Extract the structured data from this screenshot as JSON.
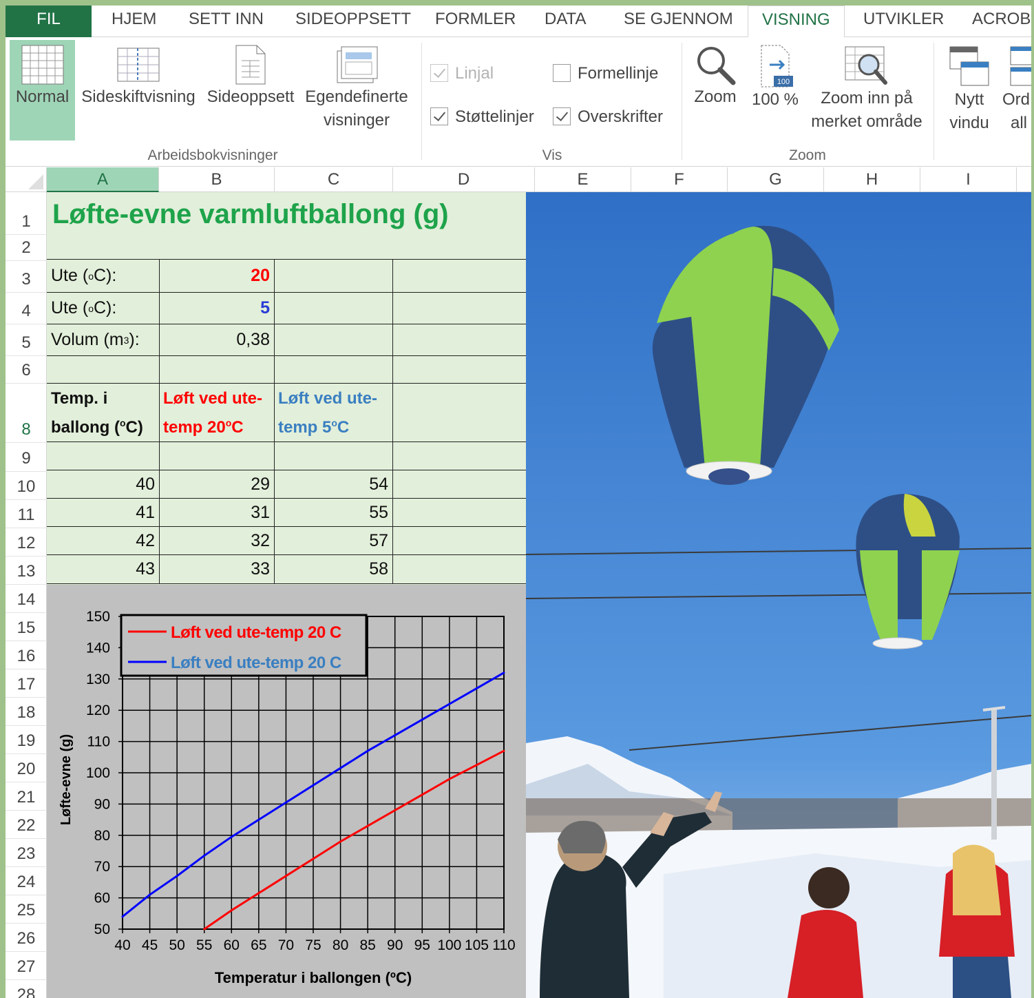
{
  "ribbon": {
    "tabs": [
      "FIL",
      "HJEM",
      "SETT INN",
      "SIDEOPPSETT",
      "FORMLER",
      "DATA",
      "SE GJENNOM",
      "VISNING",
      "UTVIKLER",
      "ACROB"
    ],
    "workbook_views": {
      "normal": "Normal",
      "page_break": "Sideskiftvisning",
      "page_layout": "Sideoppsett",
      "custom_1": "Egendefinerte",
      "custom_2": "visninger",
      "group": "Arbeidsbokvisninger"
    },
    "show": {
      "ruler": "Linjal",
      "formula_bar": "Formellinje",
      "gridlines": "Støttelinjer",
      "headings": "Overskrifter",
      "group": "Vis"
    },
    "zoom": {
      "zoom": "Zoom",
      "zoom100": "100 %",
      "zoom100_badge": "100",
      "zoom_sel_1": "Zoom inn på",
      "zoom_sel_2": "merket område",
      "group": "Zoom"
    },
    "window": {
      "new_1": "Nytt",
      "new_2": "vindu",
      "arrange_1": "Ord",
      "arrange_2": "all"
    }
  },
  "columns": [
    "A",
    "B",
    "C",
    "D",
    "E",
    "F",
    "G",
    "H",
    "I"
  ],
  "rows": [
    "1",
    "2",
    "3",
    "4",
    "5",
    "6",
    "8",
    "9",
    "10",
    "11",
    "12",
    "13",
    "14",
    "15",
    "16",
    "17",
    "18",
    "19",
    "20",
    "21",
    "22",
    "23",
    "24",
    "25",
    "26",
    "27",
    "28"
  ],
  "sheet": {
    "title": "Løfte-evne varmluftballong (g)",
    "inputs": {
      "ute_label": "Ute (",
      "deg_sup": "o",
      "ute_label_end": "C):",
      "ute1": "20",
      "ute2": "5",
      "volum_label": "Volum (m",
      "volum_sup": "3",
      "volum_label_end": "):",
      "volum": "0,38"
    },
    "headers": {
      "a1": "Temp. i",
      "a2": "ballong (",
      "a2_end": "C)",
      "b1": "Løft ved ute-",
      "b2": "temp 20",
      "b2_end": "C",
      "c1": "Løft ved ute-",
      "c2": "temp 5",
      "c2_end": "C"
    },
    "table": [
      [
        "40",
        "29",
        "54"
      ],
      [
        "41",
        "31",
        "55"
      ],
      [
        "42",
        "32",
        "57"
      ],
      [
        "43",
        "33",
        "58"
      ]
    ]
  },
  "colors": {
    "excel_green": "#217346",
    "title_green": "#1ea34b",
    "red": "#ff0000",
    "blue": "#0000ff",
    "header_blue": "#3a7fc1",
    "sheet_fill": "#e2efda"
  },
  "chart_data": {
    "type": "line",
    "title": "",
    "xlabel": "Temperatur i ballongen  (ºC)",
    "ylabel": "Løfte-evne (g)",
    "xlim": [
      40,
      110
    ],
    "ylim": [
      50,
      150
    ],
    "xticks": [
      40,
      45,
      50,
      55,
      60,
      65,
      70,
      75,
      80,
      85,
      90,
      95,
      100,
      105,
      110
    ],
    "yticks": [
      50,
      60,
      70,
      80,
      90,
      100,
      110,
      120,
      130,
      140,
      150
    ],
    "grid": true,
    "legend_position": "top-left",
    "series": [
      {
        "name": "Løft ved ute-temp 20 C",
        "color": "#ff0000",
        "x": [
          55,
          60,
          65,
          70,
          75,
          80,
          85,
          90,
          95,
          100,
          105,
          110
        ],
        "y": [
          50,
          56,
          61.5,
          67,
          72.5,
          78,
          83,
          88,
          93,
          98,
          102.5,
          107
        ]
      },
      {
        "name": "Løft ved ute-temp 20 C",
        "color": "#0000ff",
        "x": [
          40,
          45,
          50,
          55,
          60,
          65,
          70,
          75,
          80,
          85,
          90,
          95,
          100,
          105,
          110
        ],
        "y": [
          54,
          61,
          67,
          73.5,
          79.5,
          85,
          90.5,
          96,
          101.5,
          107,
          112,
          117,
          122,
          127,
          132
        ]
      }
    ]
  }
}
